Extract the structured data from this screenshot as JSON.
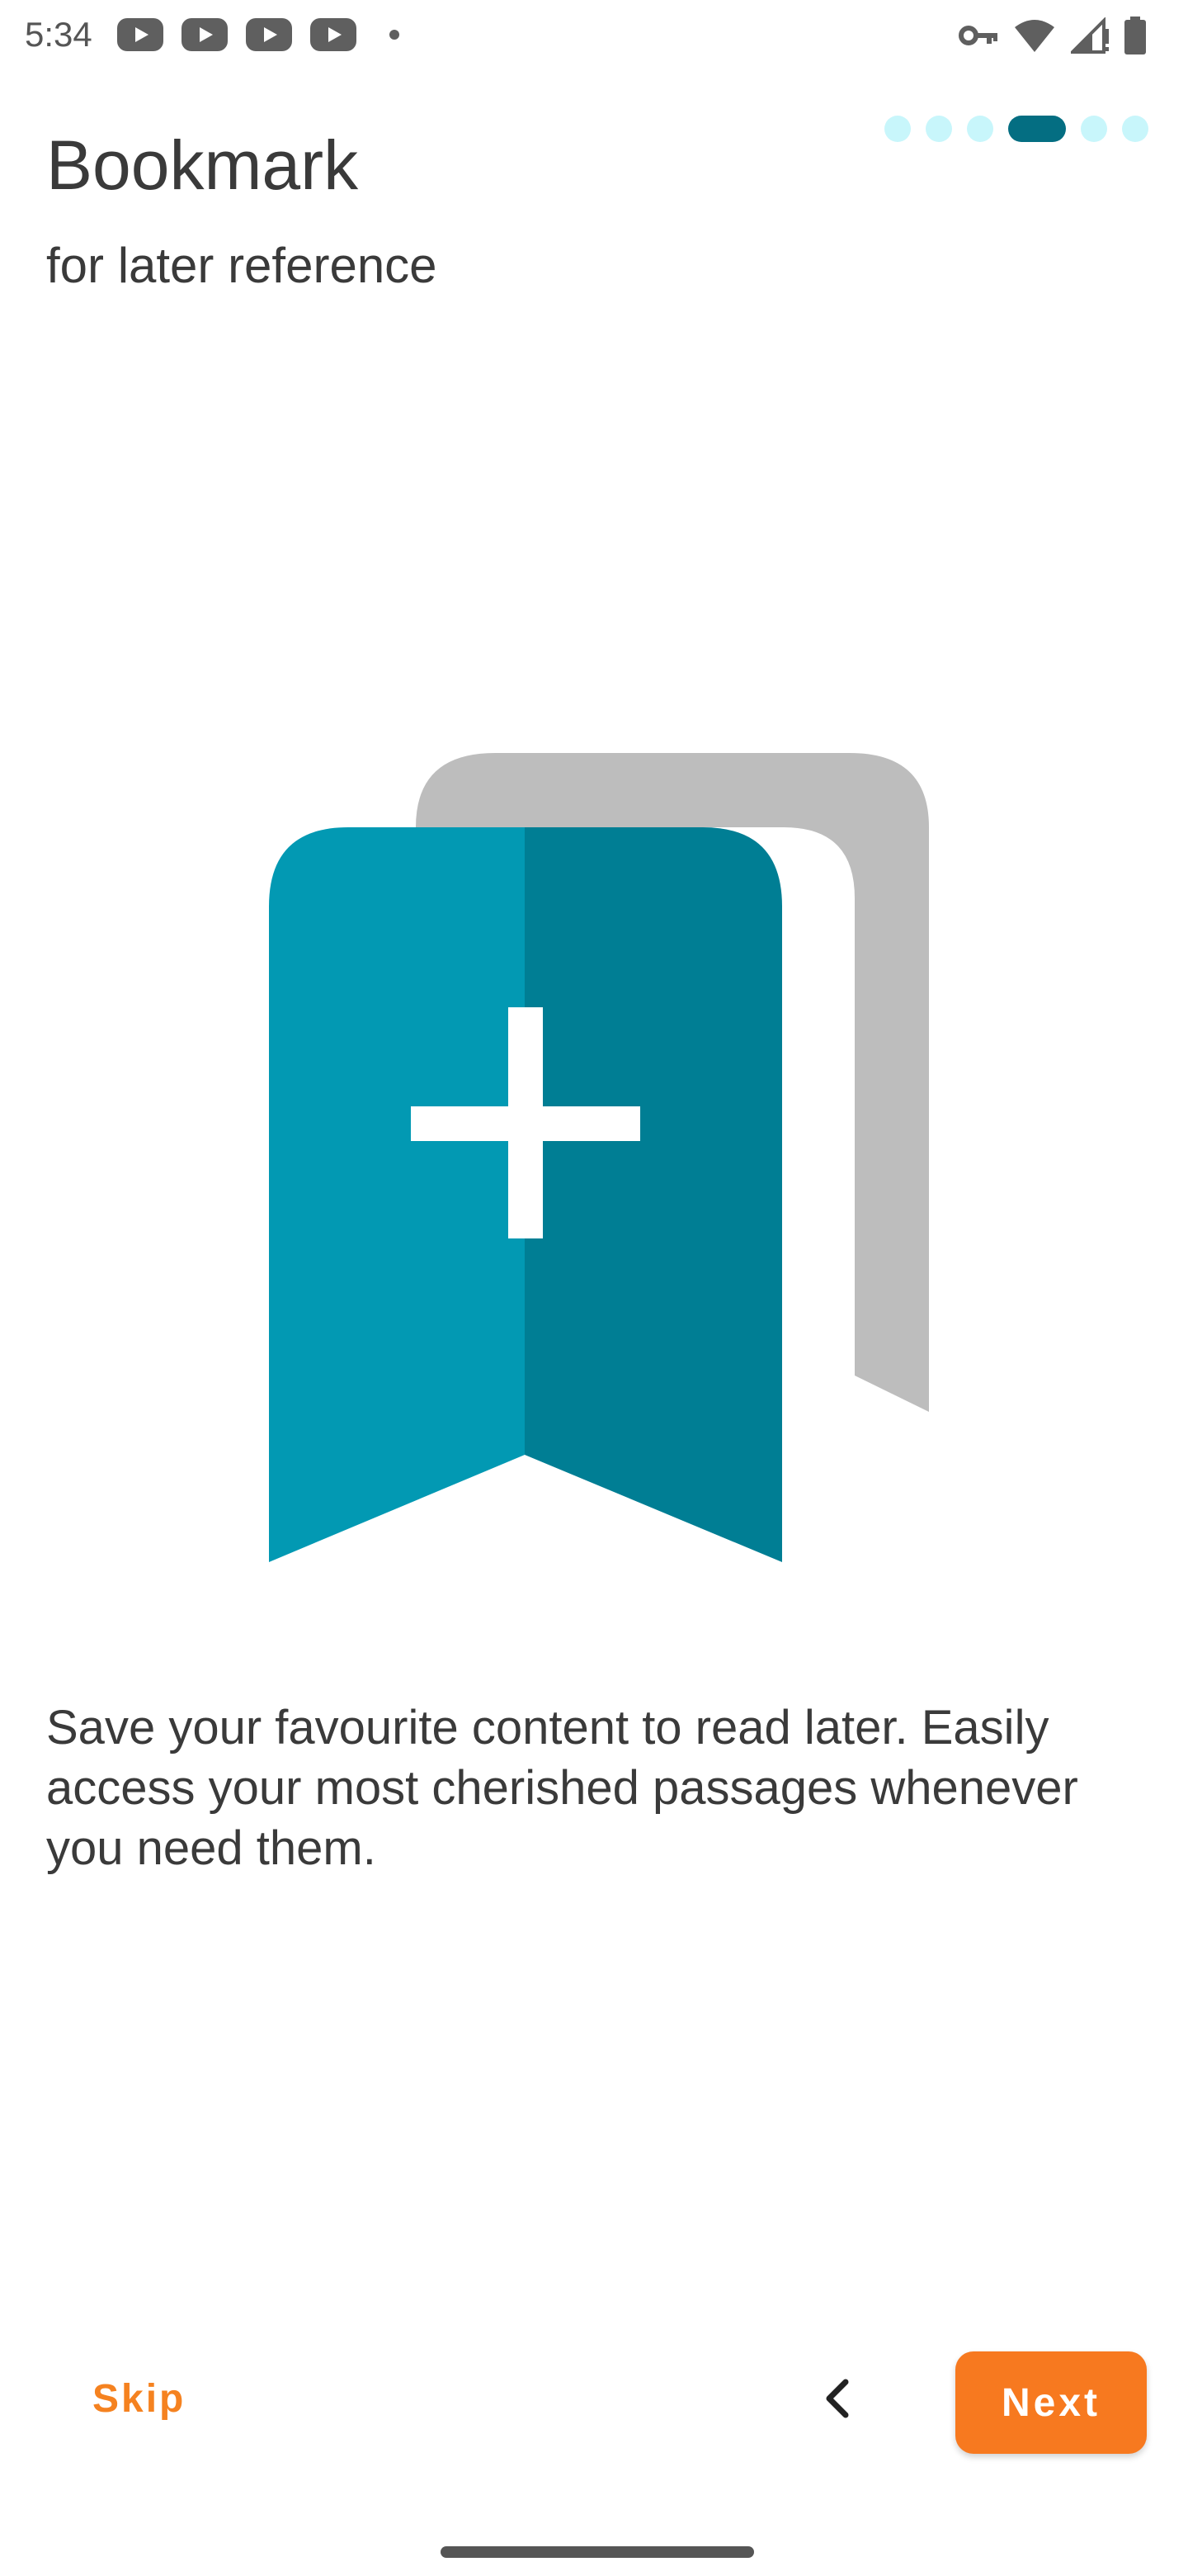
{
  "status_bar": {
    "time": "5:34",
    "left_icons": [
      "youtube-icon",
      "youtube-icon",
      "youtube-icon",
      "youtube-icon",
      "notification-dot"
    ],
    "right_icons": [
      "vpn-key-icon",
      "wifi-icon",
      "cellular-signal-icon",
      "battery-icon"
    ]
  },
  "onboarding": {
    "page_indicator": {
      "total_pages": 6,
      "current_page": 4,
      "active_color": "#046e82",
      "inactive_color": "#c8f6fb"
    },
    "title": "Bookmark",
    "subtitle": "for later reference",
    "illustration": "bookmark-add-icon",
    "description": "Save your favourite content to read later. Easily access your most cherished passages whenever you need them."
  },
  "navigation": {
    "skip_label": "Skip",
    "prev_icon": "chevron-left-icon",
    "next_label": "Next"
  },
  "colors": {
    "accent": "#f7791f",
    "bookmark_light": "#0299b3",
    "bookmark_dark": "#007e94",
    "bookmark_shadow": "#bdbdbd"
  }
}
